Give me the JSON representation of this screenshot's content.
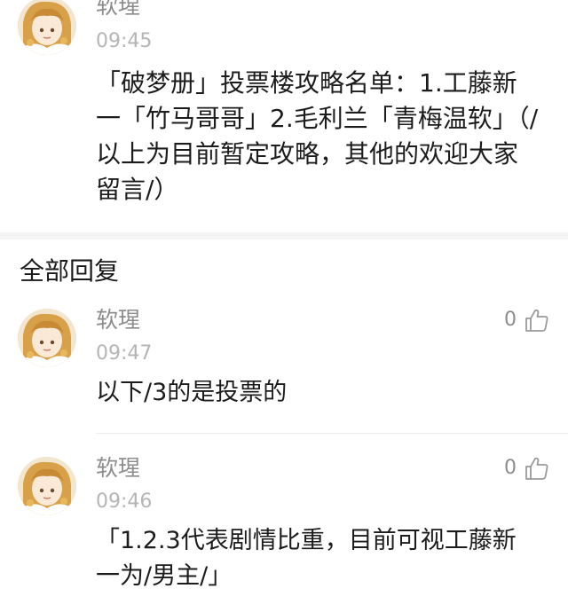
{
  "post": {
    "author": "软瑆",
    "time": "09:45",
    "text": "「破梦册」投票楼攻略名单：1.工藤新一「竹马哥哥」2.毛利兰「青梅温软」（/以上为目前暂定攻略，其他的欢迎大家留言/）",
    "avatar_icon": "anime-avatar"
  },
  "replies_section": {
    "title": "全部回复"
  },
  "replies": [
    {
      "author": "软瑆",
      "time": "09:47",
      "text": "以下/3的是投票的",
      "likes": "0",
      "like_icon": "thumbs-up-icon"
    },
    {
      "author": "软瑆",
      "time": "09:46",
      "text": "「1.2.3代表剧情比重，目前可视工藤新一为/男主/」",
      "likes": "0",
      "like_icon": "thumbs-up-icon"
    }
  ],
  "colors": {
    "username": "#8d8d8d",
    "time": "#b5b5b5",
    "body_text": "#1c1c1c",
    "divider": "#f4f4f4",
    "avatar_hair": "#d9a04a"
  }
}
